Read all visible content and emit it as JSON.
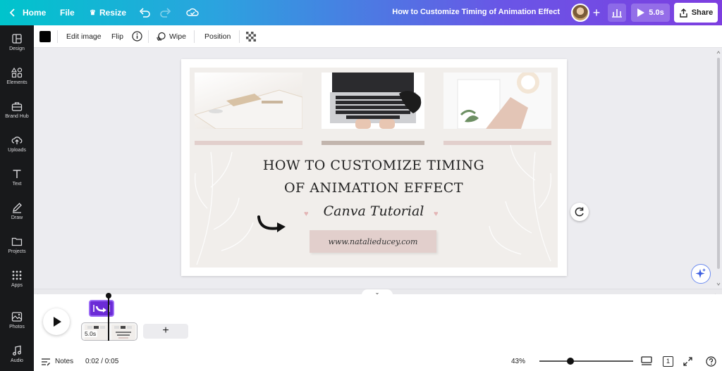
{
  "app": {
    "title": "How to Customize Timing of Animation Effect"
  },
  "topbar": {
    "home_label": "Home",
    "file_label": "File",
    "resize_label": "Resize",
    "play_label": "5.0s",
    "share_label": "Share",
    "gradient_start": "#00c4cc",
    "gradient_end": "#7d3ee0"
  },
  "sidebar": {
    "items": [
      {
        "label": "Design",
        "icon": "layout-icon"
      },
      {
        "label": "Elements",
        "icon": "shapes-icon"
      },
      {
        "label": "Brand Hub",
        "icon": "briefcase-icon"
      },
      {
        "label": "Uploads",
        "icon": "cloud-upload-icon"
      },
      {
        "label": "Text",
        "icon": "text-icon"
      },
      {
        "label": "Draw",
        "icon": "pen-icon"
      },
      {
        "label": "Projects",
        "icon": "folder-icon"
      },
      {
        "label": "Apps",
        "icon": "grid-icon"
      },
      {
        "label": "Photos",
        "icon": "image-icon"
      },
      {
        "label": "Audio",
        "icon": "music-icon"
      }
    ]
  },
  "context_toolbar": {
    "color": "#000000",
    "edit_image_label": "Edit image",
    "flip_label": "Flip",
    "animation_label": "Wipe",
    "position_label": "Position"
  },
  "design": {
    "title_line1": "HOW TO CUSTOMIZE TIMING",
    "title_line2": "OF ANIMATION EFFECT",
    "subtitle": "Canva Tutorial",
    "url": "www.natalieducey.com",
    "accent_pink": "#e2cfcc",
    "accent_taupe": "#c2b5ad"
  },
  "timeline": {
    "clip_duration": "5.0s",
    "add_label": "+"
  },
  "footer": {
    "notes_label": "Notes",
    "time": "0:02 / 0:05",
    "zoom": "43%",
    "page_count": "1",
    "zoom_fraction": 0.33
  }
}
